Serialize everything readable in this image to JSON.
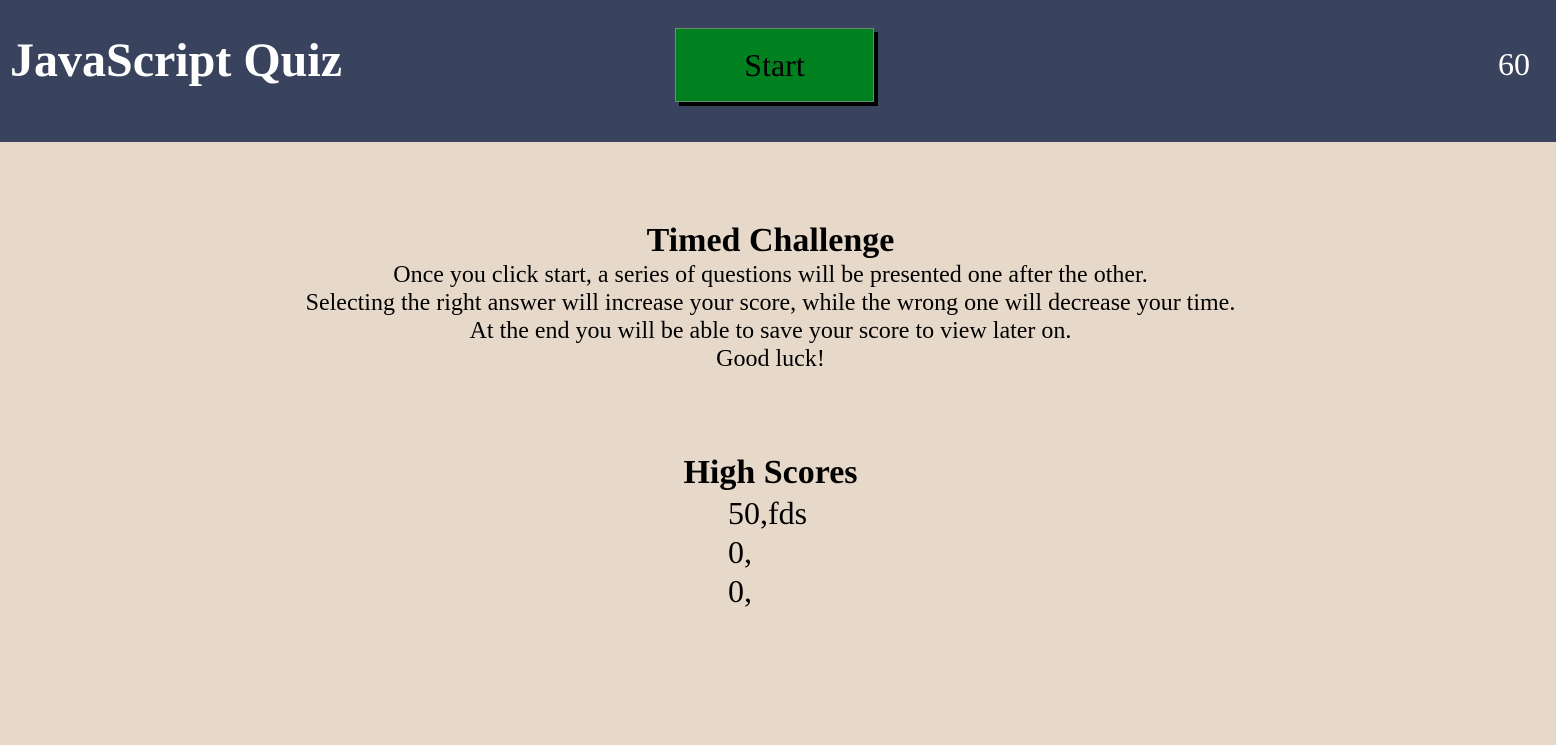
{
  "header": {
    "title": "JavaScript Quiz",
    "start_label": "Start",
    "timer": "60"
  },
  "intro": {
    "heading": "Timed Challenge",
    "lines": [
      "Once you click start, a series of questions will be presented one after the other.",
      "Selecting the right answer will increase your score, while the wrong one will decrease your time.",
      "At the end you will be able to save your score to view later on.",
      "Good luck!"
    ]
  },
  "high_scores": {
    "heading": "High Scores",
    "entries": [
      "50,fds",
      "0,",
      "0,"
    ]
  },
  "colors": {
    "header_bg": "#39435e",
    "page_bg": "#e7d9c9",
    "start_button_bg": "#00801f"
  }
}
